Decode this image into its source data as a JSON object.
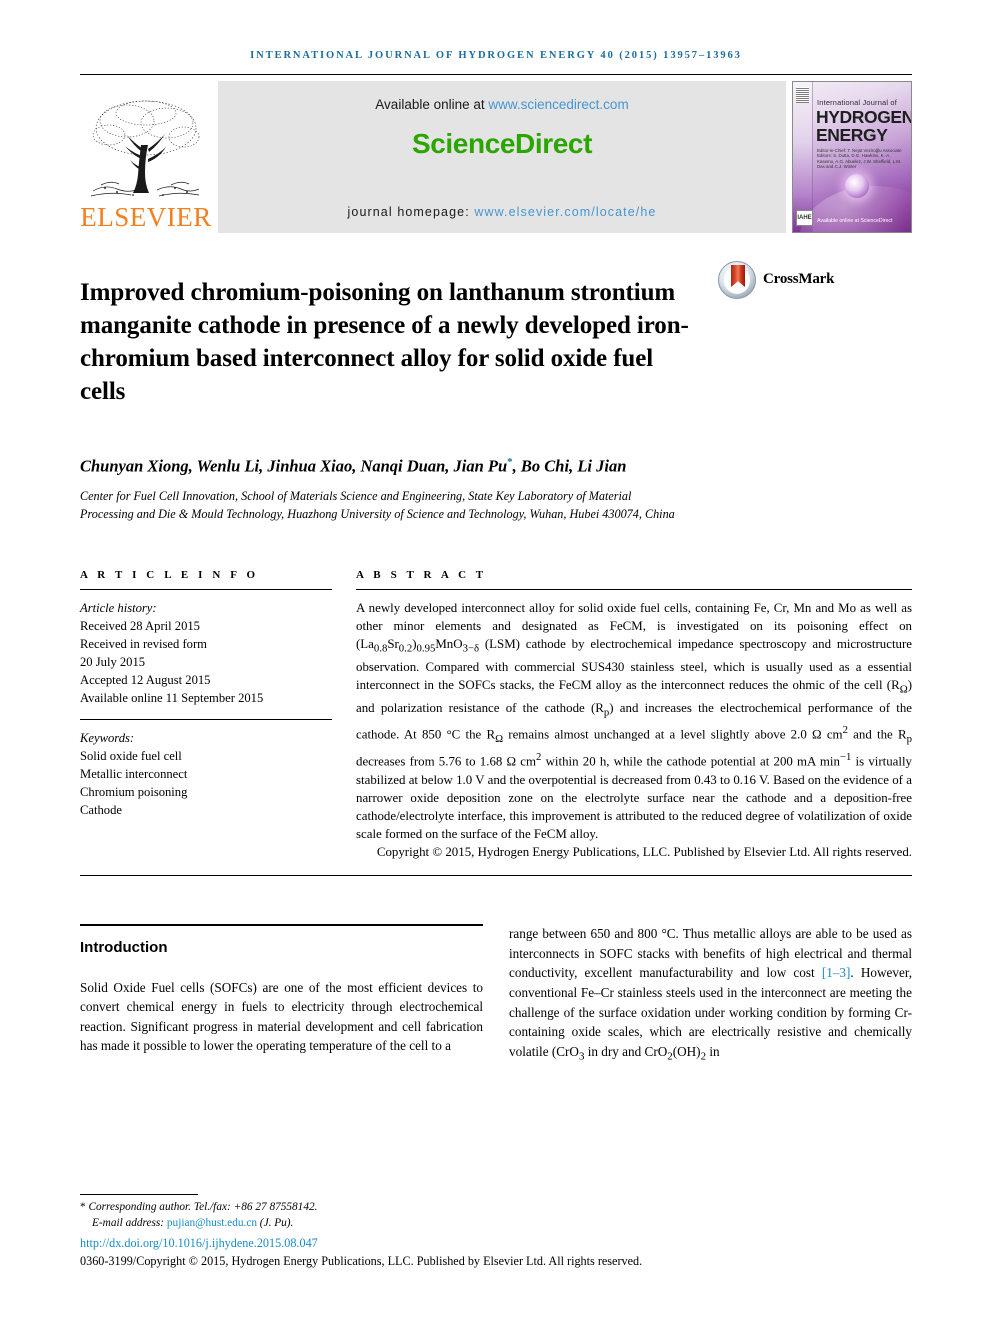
{
  "running_head": "International Journal of Hydrogen Energy 40 (2015) 13957–13963",
  "masthead": {
    "publisher_name": "ELSEVIER",
    "available_prefix": "Available online at ",
    "available_url": "www.sciencedirect.com",
    "sciencedirect_logo": "ScienceDirect",
    "homepage_prefix": "journal homepage: ",
    "homepage_url": "www.elsevier.com/locate/he",
    "cover": {
      "line_small": "International Journal of",
      "line1": "HYDROGEN",
      "line2": "ENERGY",
      "editors": "Editor-in-Chief: T. Nejat Veziroğlu\nAssociate Editors: S. Dutta, D.G. Hawkins, K.-A. Kasemo, A.G. Abuelez, J.W. Sheffield, L.M. Das and C.J. Winter",
      "badge": "IAHE",
      "sciencedirect_mark": "Available online at ScienceDirect"
    },
    "colors": {
      "elsevier_orange": "#f08020",
      "sciencedirect_green": "#2ba600",
      "link_blue": "#4596d2",
      "running_head_blue": "#1a6d9e"
    }
  },
  "article": {
    "title": "Improved chromium-poisoning on lanthanum strontium manganite cathode in presence of a newly developed iron-chromium based interconnect alloy for solid oxide fuel cells",
    "crossmark_label": "CrossMark",
    "authors": "Chunyan Xiong, Wenlu Li, Jinhua Xiao, Nanqi Duan, Jian Pu",
    "author_marker": "*",
    "authors_tail": ", Bo Chi, Li Jian",
    "affiliation": "Center for Fuel Cell Innovation, School of Materials Science and Engineering, State Key Laboratory of Material Processing and Die & Mould Technology, Huazhong University of Science and Technology, Wuhan, Hubei 430074, China"
  },
  "article_info": {
    "heading": "A R T I C L E   I N F O",
    "history_label": "Article history:",
    "history": [
      "Received 28 April 2015",
      "Received in revised form",
      "20 July 2015",
      "Accepted 12 August 2015",
      "Available online 11 September 2015"
    ],
    "keywords_label": "Keywords:",
    "keywords": [
      "Solid oxide fuel cell",
      "Metallic interconnect",
      "Chromium poisoning",
      "Cathode"
    ]
  },
  "abstract": {
    "heading": "A B S T R A C T",
    "body_part1": "A newly developed interconnect alloy for solid oxide fuel cells, containing Fe, Cr, Mn and Mo as well as other minor elements and designated as FeCM, is investigated on its poisoning effect on (La",
    "formula_la_sub": "0.8",
    "formula_sr": "Sr",
    "formula_sr_sub": "0.2",
    "formula_close": ")",
    "formula_close_sub": "0.95",
    "formula_mno": "MnO",
    "formula_mno_sub": "3−δ",
    "body_part2": " (LSM) cathode by electrochemical impedance spectroscopy and microstructure observation. Compared with commercial SUS430 stainless steel, which is usually used as a essential interconnect in the SOFCs stacks, the FeCM alloy as the interconnect reduces the ohmic of the cell (R",
    "ro_sub": "Ω",
    "body_part3": ") and polarization resistance of the cathode (R",
    "rp_sub": "p",
    "body_part4": ") and increases the electrochemical performance of the cathode. At 850 °C the R",
    "ro_sub2": "Ω",
    "body_part5": " remains almost unchanged at a level slightly above 2.0 Ω cm",
    "sup2a": "2",
    "body_part6": " and the R",
    "rp_sub2": "p",
    "body_part7": " decreases from 5.76 to 1.68 Ω cm",
    "sup2b": "2",
    "body_part8": " within 20 h, while the cathode potential at 200 mA min",
    "sup_m1": "−1",
    "body_part9": " is virtually stabilized at below 1.0 V and the overpotential is decreased from 0.43 to 0.16 V. Based on the evidence of a narrower oxide deposition zone on the electrolyte surface near the cathode and a deposition-free cathode/electrolyte interface, this improvement is attributed to the reduced degree of volatilization of oxide scale formed on the surface of the FeCM alloy.",
    "copyright": "Copyright © 2015, Hydrogen Energy Publications, LLC. Published by Elsevier Ltd. All rights reserved."
  },
  "introduction": {
    "heading": "Introduction",
    "left_text": "Solid Oxide Fuel cells (SOFCs) are one of the most efficient devices to convert chemical energy in fuels to electricity through electrochemical reaction. Significant progress in material development and cell fabrication has made it possible to lower the operating temperature of the cell to a",
    "right_part1": "range between 650 and 800 °C. Thus metallic alloys are able to be used as interconnects in SOFC stacks with benefits of high electrical and thermal conductivity, excellent manufacturability and low cost ",
    "right_citation": "[1–3]",
    "right_part2": ". However, conventional Fe–Cr stainless steels used in the interconnect are meeting the challenge of the surface oxidation under working condition by forming Cr-containing oxide scales, which are electrically resistive and chemically volatile (CrO",
    "cro3_sub": "3",
    "right_part3": " in dry and CrO",
    "cro2_sub": "2",
    "right_part4": "(OH)",
    "oh2_sub": "2",
    "right_part5": " in"
  },
  "footnote": {
    "star": "*",
    "corresponding": " Corresponding author. Tel./fax: +86 27 87558142.",
    "email_label": "E-mail address: ",
    "email": "pujian@hust.edu.cn",
    "email_tail": " (J. Pu).",
    "doi": "http://dx.doi.org/10.1016/j.ijhydene.2015.08.047",
    "issn_line": "0360-3199/Copyright © 2015, Hydrogen Energy Publications, LLC. Published by Elsevier Ltd. All rights reserved."
  }
}
